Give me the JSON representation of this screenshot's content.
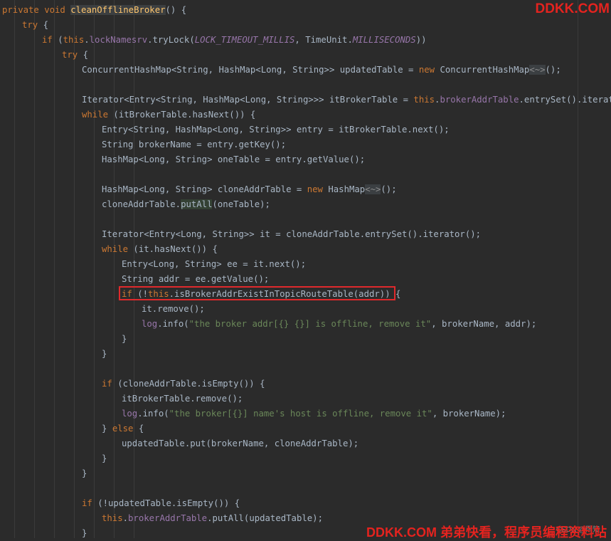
{
  "editor": {
    "lines": [
      {
        "tokens": [
          {
            "t": "private void ",
            "c": "kw"
          },
          {
            "t": "cleanOfflineBroker",
            "c": "fn hl"
          },
          {
            "t": "() {"
          }
        ]
      },
      {
        "tokens": [
          {
            "t": "try",
            "c": "kw"
          },
          {
            "t": " {"
          }
        ]
      },
      {
        "tokens": [
          {
            "t": "if",
            "c": "kw"
          },
          {
            "t": " ("
          },
          {
            "t": "this",
            "c": "kw"
          },
          {
            "t": "."
          },
          {
            "t": "lockNamesrv",
            "c": "fld"
          },
          {
            "t": ".tryLock("
          },
          {
            "t": "LOCK_TIMEOUT_MILLIS",
            "c": "cst"
          },
          {
            "t": ", TimeUnit."
          },
          {
            "t": "MILLISECONDS",
            "c": "cst"
          },
          {
            "t": "))"
          }
        ]
      },
      {
        "tokens": [
          {
            "t": "try",
            "c": "kw"
          },
          {
            "t": " {"
          }
        ]
      },
      {
        "tokens": [
          {
            "t": "ConcurrentHashMap<String, HashMap<Long, String>> updatedTable = "
          },
          {
            "t": "new",
            "c": "kw"
          },
          {
            "t": " ConcurrentHashMap"
          },
          {
            "t": "<~>",
            "c": "fold"
          },
          {
            "t": "();"
          }
        ]
      },
      {
        "tokens": []
      },
      {
        "tokens": [
          {
            "t": "Iterator<Entry<String, HashMap<Long, String>>> itBrokerTable = "
          },
          {
            "t": "this",
            "c": "kw"
          },
          {
            "t": "."
          },
          {
            "t": "brokerAddrTable",
            "c": "fld"
          },
          {
            "t": ".entrySet().iterator();"
          }
        ]
      },
      {
        "tokens": [
          {
            "t": "while",
            "c": "kw"
          },
          {
            "t": " (itBrokerTable.hasNext()) {"
          }
        ]
      },
      {
        "tokens": [
          {
            "t": "Entry<String, HashMap<Long, String>> entry = itBrokerTable.next();"
          }
        ]
      },
      {
        "tokens": [
          {
            "t": "String brokerName = entry.getKey();"
          }
        ]
      },
      {
        "tokens": [
          {
            "t": "HashMap<Long, String> oneTable = entry.getValue();"
          }
        ]
      },
      {
        "tokens": []
      },
      {
        "tokens": [
          {
            "t": "HashMap<Long, String> cloneAddrTable = "
          },
          {
            "t": "new",
            "c": "kw"
          },
          {
            "t": " HashMap"
          },
          {
            "t": "<~>",
            "c": "fold"
          },
          {
            "t": "();"
          }
        ]
      },
      {
        "tokens": [
          {
            "t": "cloneAddrTable."
          },
          {
            "t": "putAll",
            "c": "hl2"
          },
          {
            "t": "(oneTable);"
          }
        ]
      },
      {
        "tokens": []
      },
      {
        "tokens": [
          {
            "t": "Iterator<Entry<Long, String>> it = cloneAddrTable.entrySet().iterator();"
          }
        ]
      },
      {
        "tokens": [
          {
            "t": "while",
            "c": "kw"
          },
          {
            "t": " (it.hasNext()) {"
          }
        ]
      },
      {
        "tokens": [
          {
            "t": "Entry<Long, String> ee = it.next();"
          }
        ]
      },
      {
        "tokens": [
          {
            "t": "String addr = ee.getValue();"
          }
        ]
      },
      {
        "tokens": [
          {
            "t": "if",
            "c": "kw"
          },
          {
            "t": " (!"
          },
          {
            "t": "this",
            "c": "kw"
          },
          {
            "t": ".isBrokerAddrExistInTopicRouteTable(addr)) {"
          }
        ]
      },
      {
        "tokens": [
          {
            "t": "it.remove();"
          }
        ]
      },
      {
        "tokens": [
          {
            "t": "log",
            "c": "fld"
          },
          {
            "t": ".info("
          },
          {
            "t": "\"the broker addr[{} {}] is offline, remove it\"",
            "c": "str"
          },
          {
            "t": ", brokerName, addr);"
          }
        ]
      },
      {
        "tokens": [
          {
            "t": "}"
          }
        ]
      },
      {
        "tokens": [
          {
            "t": "}"
          }
        ]
      },
      {
        "tokens": []
      },
      {
        "tokens": [
          {
            "t": "if",
            "c": "kw"
          },
          {
            "t": " (cloneAddrTable.isEmpty()) {"
          }
        ]
      },
      {
        "tokens": [
          {
            "t": "itBrokerTable.remove();"
          }
        ]
      },
      {
        "tokens": [
          {
            "t": "log",
            "c": "fld"
          },
          {
            "t": ".info("
          },
          {
            "t": "\"the broker[{}] name's host is offline, remove it\"",
            "c": "str"
          },
          {
            "t": ", brokerName);"
          }
        ]
      },
      {
        "tokens": [
          {
            "t": "} "
          },
          {
            "t": "else",
            "c": "kw"
          },
          {
            "t": " {"
          }
        ]
      },
      {
        "tokens": [
          {
            "t": "updatedTable.put(brokerName, cloneAddrTable);"
          }
        ]
      },
      {
        "tokens": [
          {
            "t": "}"
          }
        ]
      },
      {
        "tokens": [
          {
            "t": "}"
          }
        ]
      },
      {
        "tokens": []
      },
      {
        "tokens": [
          {
            "t": "if",
            "c": "kw"
          },
          {
            "t": " (!updatedTable.isEmpty()) {"
          }
        ]
      },
      {
        "tokens": [
          {
            "t": "this",
            "c": "kw"
          },
          {
            "t": "."
          },
          {
            "t": "brokerAddrTable",
            "c": "fld"
          },
          {
            "t": ".putAll(updatedTable);"
          }
        ]
      },
      {
        "tokens": [
          {
            "t": "}"
          }
        ]
      }
    ],
    "highlighted_line_index": 19
  },
  "watermarks": {
    "top_right": "DDKK.COM",
    "bottom": "DDKK.COM 弟弟快看，程序员编程资料站",
    "csdn": "CSDN @雨知"
  },
  "colors": {
    "background": "#2b2b2b",
    "keyword": "#cc7832",
    "method_declaration": "#ffc66d",
    "field": "#9876aa",
    "string": "#6a8759",
    "default_text": "#a9b7c6",
    "highlight_box": "#e0292c",
    "watermark": "#e4231f"
  }
}
